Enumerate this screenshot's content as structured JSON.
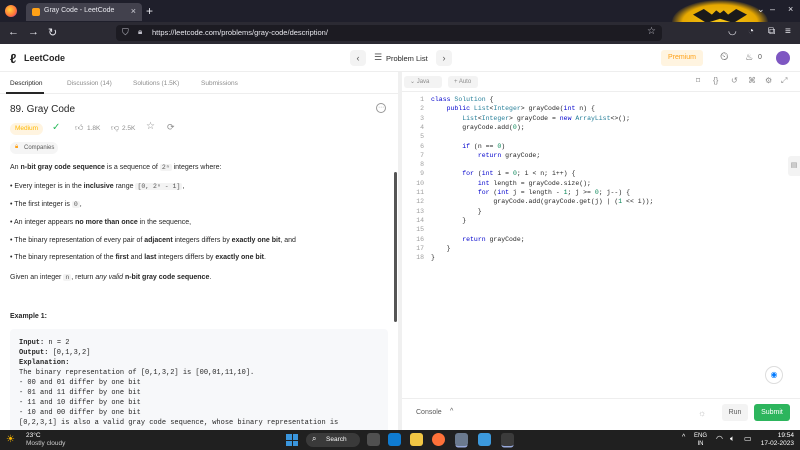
{
  "browser": {
    "tab_title": "Gray Code - LeetCode",
    "url": "https://leetcode.com/problems/gray-code/description/"
  },
  "header": {
    "logo": "LeetCode",
    "problem_list": "Problem List",
    "premium": "Premium",
    "streak_count": "0"
  },
  "left_tabs": [
    "Description",
    "Discussion (14)",
    "Solutions (1.5K)",
    "Submissions"
  ],
  "problem": {
    "title": "89. Gray Code",
    "difficulty": "Medium",
    "likes": "1.8K",
    "dislikes": "2.5K",
    "companies": "Companies",
    "intro_a": "An ",
    "intro_bold": "n-bit gray code sequence",
    "intro_b": " is a sequence of ",
    "intro_code": "2ⁿ",
    "intro_c": " integers where:",
    "b1_a": "Every integer is in the ",
    "b1_bold": "inclusive",
    "b1_b": " range ",
    "b1_code": "[0, 2ⁿ - 1]",
    "b1_c": ",",
    "b2_a": "The first integer is ",
    "b2_code": "0",
    "b2_b": ",",
    "b3_a": "An integer appears ",
    "b3_bold": "no more than once",
    "b3_b": " in the sequence,",
    "b4_a": "The binary representation of every pair of ",
    "b4_bold1": "adjacent",
    "b4_b": " integers differs by ",
    "b4_bold2": "exactly one bit",
    "b4_c": ", and",
    "b5_a": "The binary representation of the ",
    "b5_bold1": "first",
    "b5_b": " and ",
    "b5_bold2": "last",
    "b5_c": " integers differs by ",
    "b5_bold3": "exactly one bit",
    "b5_d": ".",
    "given_a": "Given an integer ",
    "given_code": "n",
    "given_b": ", return ",
    "given_italic": "any valid",
    "given_c": " ",
    "given_bold": "n-bit gray code sequence",
    "given_d": ".",
    "example_title": "Example 1:",
    "example_lines": [
      "Input: n = 2",
      "Output: [0,1,3,2]",
      "Explanation:",
      "The binary representation of [0,1,3,2] is [00,01,11,10].",
      "- 00 and 01 differ by one bit",
      "- 01 and 11 differ by one bit",
      "- 11 and 10 differ by one bit",
      "- 10 and 00 differ by one bit",
      "[0,2,3,1] is also a valid gray code sequence, whose binary representation is"
    ]
  },
  "editor": {
    "language": "Java",
    "mode": "Auto",
    "line_numbers": [
      "1",
      "2",
      "3",
      "4",
      "5",
      "6",
      "7",
      "8",
      "9",
      "10",
      "11",
      "12",
      "13",
      "14",
      "15",
      "16",
      "17",
      "18"
    ],
    "code": [
      "class Solution {",
      "    public List<Integer> grayCode(int n) {",
      "        List<Integer> grayCode = new ArrayList<>();",
      "        grayCode.add(0);",
      "",
      "        if (n == 0)",
      "            return grayCode;",
      "",
      "        for (int i = 0; i < n; i++) {",
      "            int length = grayCode.size();",
      "            for (int j = length - 1; j >= 0; j--) {",
      "                grayCode.add(grayCode.get(j) | (1 << i));",
      "            }",
      "        }",
      "",
      "        return grayCode;",
      "    }",
      "}"
    ],
    "console": "Console",
    "run": "Run",
    "submit": "Submit"
  },
  "taskbar": {
    "temperature": "23°C",
    "weather": "Mostly cloudy",
    "search": "Search",
    "lang_top": "ENG",
    "lang_bottom": "IN",
    "time": "19:54",
    "date": "17-02-2023"
  },
  "colors": {
    "accent": "#ffa116",
    "submit": "#2db55d",
    "medium": "#ffb800"
  }
}
